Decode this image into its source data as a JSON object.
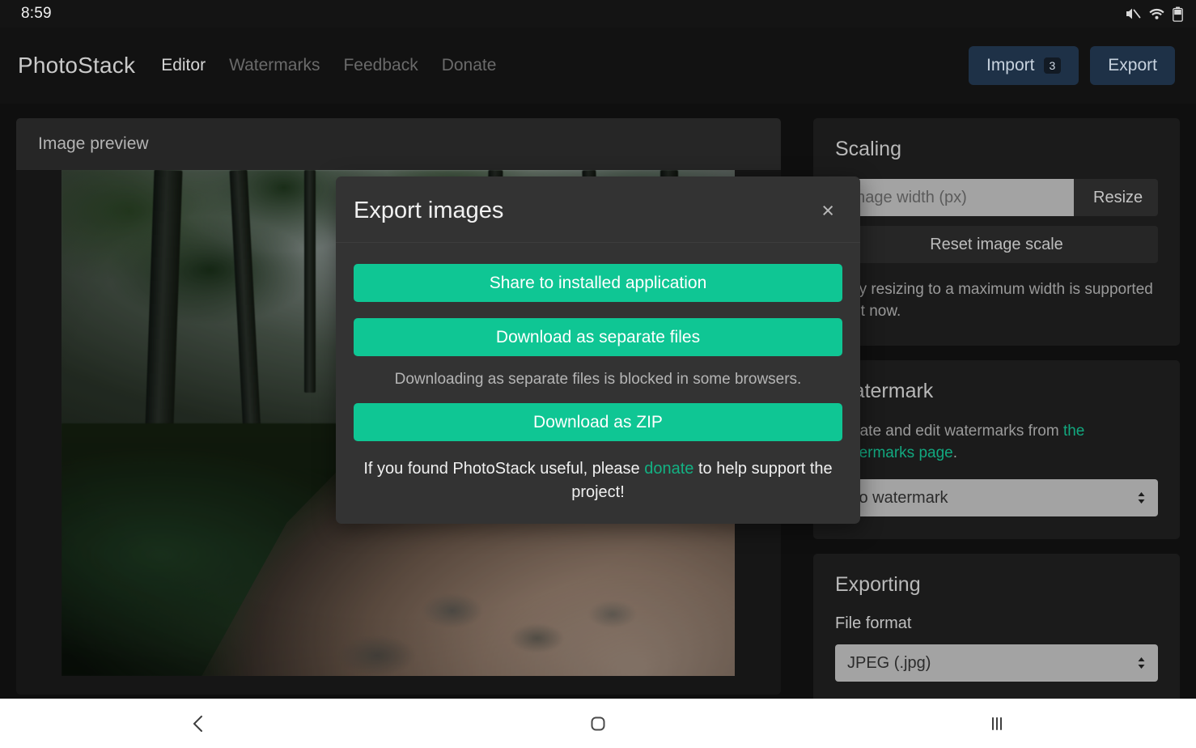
{
  "status_bar": {
    "clock": "8:59",
    "icons": [
      "mute-icon",
      "wifi-icon",
      "battery-icon"
    ]
  },
  "header": {
    "brand": "PhotoStack",
    "nav": [
      {
        "label": "Editor",
        "active": true
      },
      {
        "label": "Watermarks",
        "active": false
      },
      {
        "label": "Feedback",
        "active": false
      },
      {
        "label": "Donate",
        "active": false
      }
    ],
    "import_label": "Import",
    "import_badge": "3",
    "export_label": "Export"
  },
  "preview": {
    "title": "Image preview"
  },
  "scaling": {
    "heading": "Scaling",
    "width_placeholder": "Image width (px)",
    "width_value": "",
    "resize_label": "Resize",
    "reset_label": "Reset image scale",
    "hint": "Only resizing to a maximum width is supported right now."
  },
  "watermark": {
    "heading": "Watermark",
    "hint_prefix": "Create and edit watermarks from ",
    "hint_link": "the watermarks page",
    "hint_suffix": ".",
    "selected": "No watermark",
    "options": [
      "No watermark"
    ]
  },
  "exporting": {
    "heading": "Exporting",
    "format_label": "File format",
    "format_selected": "JPEG (.jpg)",
    "format_options": [
      "JPEG (.jpg)"
    ]
  },
  "modal": {
    "title": "Export images",
    "close_icon": "×",
    "share_label": "Share to installed application",
    "separate_label": "Download as separate files",
    "note": "Downloading as separate files is blocked in some browsers.",
    "zip_label": "Download as ZIP",
    "footer_prefix": "If you found PhotoStack useful, please ",
    "footer_link": "donate",
    "footer_suffix": " to help support the project!"
  },
  "nav_bar": {
    "back": "back-icon",
    "home": "home-icon",
    "recents": "recents-icon"
  },
  "colors": {
    "accent_green": "#0fc694",
    "link_green": "#13b183",
    "header_button": "#1e3147",
    "app_background": "#0f0f0f",
    "panel": "#1b1b1b",
    "modal": "#333333"
  }
}
